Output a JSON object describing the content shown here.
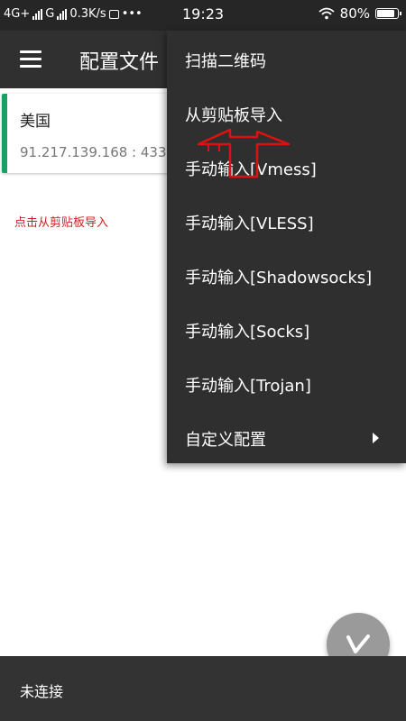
{
  "status_bar": {
    "network": "4G+",
    "carrier2": "G",
    "speed": "0.3K/s",
    "dots": "•••",
    "time": "19:23",
    "battery": "80%"
  },
  "toolbar": {
    "title": "配置文件"
  },
  "server_list": [
    {
      "name": "美国",
      "address": "91.217.139.168 : 433"
    }
  ],
  "hint": "点击从剪贴板导入",
  "menu": {
    "items": [
      {
        "label": "扫描二维码"
      },
      {
        "label": "从剪贴板导入"
      },
      {
        "label": "手动输入[Vmess]"
      },
      {
        "label": "手动输入[VLESS]"
      },
      {
        "label": "手动输入[Shadowsocks]"
      },
      {
        "label": "手动输入[Socks]"
      },
      {
        "label": "手动输入[Trojan]"
      },
      {
        "label": "自定义配置",
        "has_submenu": true
      }
    ]
  },
  "bottom_bar": {
    "status": "未连接"
  },
  "colors": {
    "accent_green": "#1aa064",
    "annotation_red": "#e01010",
    "menu_bg": "#2f2f2f",
    "toolbar_bg": "#303030"
  },
  "icons": {
    "menu": "hamburger-icon",
    "fab": "v-logo-icon",
    "wifi": "wifi-icon",
    "signal": "signal-icon"
  }
}
